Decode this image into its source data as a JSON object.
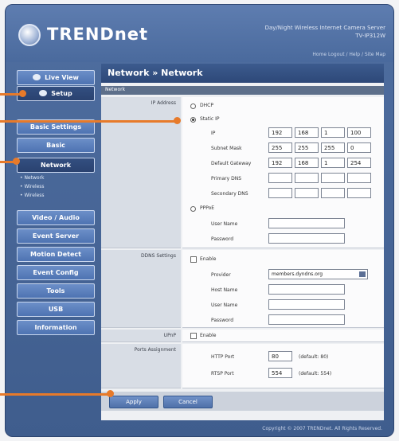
{
  "header": {
    "brand": "TRENDnet",
    "product": "Day/Night Wireless Internet Camera Server",
    "model": "TV-IP312W",
    "nav": "Home    Logout / Help / Site Map"
  },
  "sidebar": {
    "live_view": "Live View",
    "setup": "Setup",
    "items": [
      {
        "label": "Basic Settings"
      },
      {
        "label": "Basic"
      },
      {
        "label": "Network"
      },
      {
        "label": "Video / Audio"
      },
      {
        "label": "Event Server"
      },
      {
        "label": "Motion Detect"
      },
      {
        "label": "Event Config"
      },
      {
        "label": "Tools"
      },
      {
        "label": "USB"
      },
      {
        "label": "Information"
      }
    ],
    "network_subitems": [
      "• Network",
      "• Wireless",
      "• Wireless"
    ]
  },
  "content": {
    "title": "Network » Network",
    "section": "Network",
    "ip_address_label": "IP Address",
    "dhcp_label": "DHCP",
    "static_ip_label": "Static IP",
    "ip_label": "IP",
    "subnet_label": "Subnet Mask",
    "gateway_label": "Default Gateway",
    "primary_dns_label": "Primary DNS",
    "secondary_dns_label": "Secondary DNS",
    "pppoe_label": "PPPoE",
    "user_name_label": "User Name",
    "password_label": "Password",
    "ip": [
      "192",
      "168",
      "1",
      "100"
    ],
    "subnet": [
      "255",
      "255",
      "255",
      "0"
    ],
    "gateway": [
      "192",
      "168",
      "1",
      "254"
    ],
    "ddns_settings_label": "DDNS Settings",
    "ddns_enable": "Enable",
    "provider_label": "Provider",
    "provider_value": "members.dyndns.org",
    "host_name_label": "Host Name",
    "user_name2_label": "User Name",
    "password2_label": "Password",
    "upnp_label": "UPnP",
    "upnp_enable": "Enable",
    "ports_label": "Ports Assignment",
    "http_port_label": "HTTP Port",
    "http_port": "80",
    "http_default": "(default: 80)",
    "rtsp_port_label": "RTSP Port",
    "rtsp_port": "554",
    "rtsp_default": "(default: 554)",
    "apply": "Apply",
    "cancel": "Cancel"
  },
  "footer": "Copyright © 2007 TRENDnet. All Rights Reserved."
}
